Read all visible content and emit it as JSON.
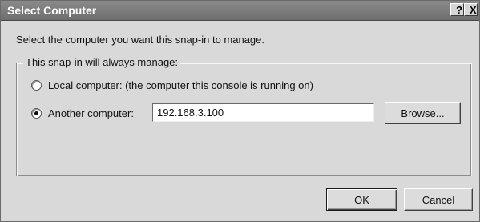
{
  "window": {
    "title": "Select Computer",
    "help_label": "?",
    "close_label": "X"
  },
  "intro_text": "Select the computer you want this snap-in to manage.",
  "group": {
    "legend": "This snap-in will always manage:",
    "options": [
      {
        "label": "Local computer:  (the computer this console is running on)",
        "checked": false
      },
      {
        "label": "Another computer:",
        "checked": true
      }
    ],
    "computer_value": "192.168.3.100",
    "browse_label": "Browse..."
  },
  "buttons": {
    "ok_label": "OK",
    "cancel_label": "Cancel"
  }
}
